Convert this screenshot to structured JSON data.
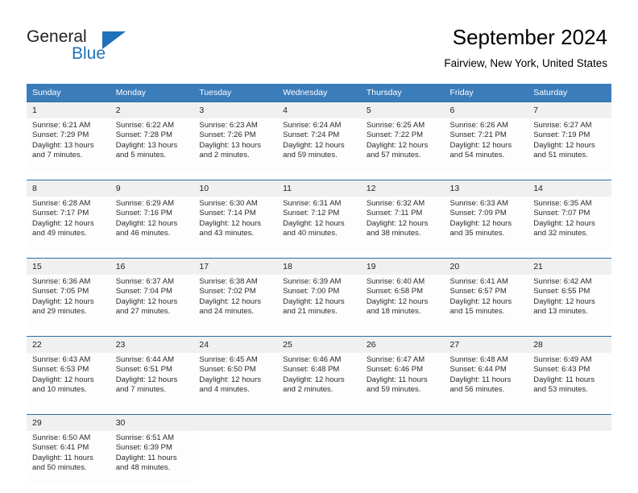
{
  "brand": {
    "name_part1": "General",
    "name_part2": "Blue",
    "flag_icon": "triangle-flag-icon",
    "accent_color": "#1f71b8"
  },
  "header": {
    "title": "September 2024",
    "location": "Fairview, New York, United States"
  },
  "calendar": {
    "header_bg": "#3b7cba",
    "daynum_bg": "#f0f0f0",
    "separator_color": "#2e6da4",
    "weekday_headers": [
      "Sunday",
      "Monday",
      "Tuesday",
      "Wednesday",
      "Thursday",
      "Friday",
      "Saturday"
    ],
    "weeks": [
      [
        {
          "day": "1",
          "sunrise": "Sunrise: 6:21 AM",
          "sunset": "Sunset: 7:29 PM",
          "daylight_line1": "Daylight: 13 hours",
          "daylight_line2": "and 7 minutes."
        },
        {
          "day": "2",
          "sunrise": "Sunrise: 6:22 AM",
          "sunset": "Sunset: 7:28 PM",
          "daylight_line1": "Daylight: 13 hours",
          "daylight_line2": "and 5 minutes."
        },
        {
          "day": "3",
          "sunrise": "Sunrise: 6:23 AM",
          "sunset": "Sunset: 7:26 PM",
          "daylight_line1": "Daylight: 13 hours",
          "daylight_line2": "and 2 minutes."
        },
        {
          "day": "4",
          "sunrise": "Sunrise: 6:24 AM",
          "sunset": "Sunset: 7:24 PM",
          "daylight_line1": "Daylight: 12 hours",
          "daylight_line2": "and 59 minutes."
        },
        {
          "day": "5",
          "sunrise": "Sunrise: 6:25 AM",
          "sunset": "Sunset: 7:22 PM",
          "daylight_line1": "Daylight: 12 hours",
          "daylight_line2": "and 57 minutes."
        },
        {
          "day": "6",
          "sunrise": "Sunrise: 6:26 AM",
          "sunset": "Sunset: 7:21 PM",
          "daylight_line1": "Daylight: 12 hours",
          "daylight_line2": "and 54 minutes."
        },
        {
          "day": "7",
          "sunrise": "Sunrise: 6:27 AM",
          "sunset": "Sunset: 7:19 PM",
          "daylight_line1": "Daylight: 12 hours",
          "daylight_line2": "and 51 minutes."
        }
      ],
      [
        {
          "day": "8",
          "sunrise": "Sunrise: 6:28 AM",
          "sunset": "Sunset: 7:17 PM",
          "daylight_line1": "Daylight: 12 hours",
          "daylight_line2": "and 49 minutes."
        },
        {
          "day": "9",
          "sunrise": "Sunrise: 6:29 AM",
          "sunset": "Sunset: 7:16 PM",
          "daylight_line1": "Daylight: 12 hours",
          "daylight_line2": "and 46 minutes."
        },
        {
          "day": "10",
          "sunrise": "Sunrise: 6:30 AM",
          "sunset": "Sunset: 7:14 PM",
          "daylight_line1": "Daylight: 12 hours",
          "daylight_line2": "and 43 minutes."
        },
        {
          "day": "11",
          "sunrise": "Sunrise: 6:31 AM",
          "sunset": "Sunset: 7:12 PM",
          "daylight_line1": "Daylight: 12 hours",
          "daylight_line2": "and 40 minutes."
        },
        {
          "day": "12",
          "sunrise": "Sunrise: 6:32 AM",
          "sunset": "Sunset: 7:11 PM",
          "daylight_line1": "Daylight: 12 hours",
          "daylight_line2": "and 38 minutes."
        },
        {
          "day": "13",
          "sunrise": "Sunrise: 6:33 AM",
          "sunset": "Sunset: 7:09 PM",
          "daylight_line1": "Daylight: 12 hours",
          "daylight_line2": "and 35 minutes."
        },
        {
          "day": "14",
          "sunrise": "Sunrise: 6:35 AM",
          "sunset": "Sunset: 7:07 PM",
          "daylight_line1": "Daylight: 12 hours",
          "daylight_line2": "and 32 minutes."
        }
      ],
      [
        {
          "day": "15",
          "sunrise": "Sunrise: 6:36 AM",
          "sunset": "Sunset: 7:05 PM",
          "daylight_line1": "Daylight: 12 hours",
          "daylight_line2": "and 29 minutes."
        },
        {
          "day": "16",
          "sunrise": "Sunrise: 6:37 AM",
          "sunset": "Sunset: 7:04 PM",
          "daylight_line1": "Daylight: 12 hours",
          "daylight_line2": "and 27 minutes."
        },
        {
          "day": "17",
          "sunrise": "Sunrise: 6:38 AM",
          "sunset": "Sunset: 7:02 PM",
          "daylight_line1": "Daylight: 12 hours",
          "daylight_line2": "and 24 minutes."
        },
        {
          "day": "18",
          "sunrise": "Sunrise: 6:39 AM",
          "sunset": "Sunset: 7:00 PM",
          "daylight_line1": "Daylight: 12 hours",
          "daylight_line2": "and 21 minutes."
        },
        {
          "day": "19",
          "sunrise": "Sunrise: 6:40 AM",
          "sunset": "Sunset: 6:58 PM",
          "daylight_line1": "Daylight: 12 hours",
          "daylight_line2": "and 18 minutes."
        },
        {
          "day": "20",
          "sunrise": "Sunrise: 6:41 AM",
          "sunset": "Sunset: 6:57 PM",
          "daylight_line1": "Daylight: 12 hours",
          "daylight_line2": "and 15 minutes."
        },
        {
          "day": "21",
          "sunrise": "Sunrise: 6:42 AM",
          "sunset": "Sunset: 6:55 PM",
          "daylight_line1": "Daylight: 12 hours",
          "daylight_line2": "and 13 minutes."
        }
      ],
      [
        {
          "day": "22",
          "sunrise": "Sunrise: 6:43 AM",
          "sunset": "Sunset: 6:53 PM",
          "daylight_line1": "Daylight: 12 hours",
          "daylight_line2": "and 10 minutes."
        },
        {
          "day": "23",
          "sunrise": "Sunrise: 6:44 AM",
          "sunset": "Sunset: 6:51 PM",
          "daylight_line1": "Daylight: 12 hours",
          "daylight_line2": "and 7 minutes."
        },
        {
          "day": "24",
          "sunrise": "Sunrise: 6:45 AM",
          "sunset": "Sunset: 6:50 PM",
          "daylight_line1": "Daylight: 12 hours",
          "daylight_line2": "and 4 minutes."
        },
        {
          "day": "25",
          "sunrise": "Sunrise: 6:46 AM",
          "sunset": "Sunset: 6:48 PM",
          "daylight_line1": "Daylight: 12 hours",
          "daylight_line2": "and 2 minutes."
        },
        {
          "day": "26",
          "sunrise": "Sunrise: 6:47 AM",
          "sunset": "Sunset: 6:46 PM",
          "daylight_line1": "Daylight: 11 hours",
          "daylight_line2": "and 59 minutes."
        },
        {
          "day": "27",
          "sunrise": "Sunrise: 6:48 AM",
          "sunset": "Sunset: 6:44 PM",
          "daylight_line1": "Daylight: 11 hours",
          "daylight_line2": "and 56 minutes."
        },
        {
          "day": "28",
          "sunrise": "Sunrise: 6:49 AM",
          "sunset": "Sunset: 6:43 PM",
          "daylight_line1": "Daylight: 11 hours",
          "daylight_line2": "and 53 minutes."
        }
      ],
      [
        {
          "day": "29",
          "sunrise": "Sunrise: 6:50 AM",
          "sunset": "Sunset: 6:41 PM",
          "daylight_line1": "Daylight: 11 hours",
          "daylight_line2": "and 50 minutes."
        },
        {
          "day": "30",
          "sunrise": "Sunrise: 6:51 AM",
          "sunset": "Sunset: 6:39 PM",
          "daylight_line1": "Daylight: 11 hours",
          "daylight_line2": "and 48 minutes."
        },
        {
          "day": "",
          "sunrise": "",
          "sunset": "",
          "daylight_line1": "",
          "daylight_line2": ""
        },
        {
          "day": "",
          "sunrise": "",
          "sunset": "",
          "daylight_line1": "",
          "daylight_line2": ""
        },
        {
          "day": "",
          "sunrise": "",
          "sunset": "",
          "daylight_line1": "",
          "daylight_line2": ""
        },
        {
          "day": "",
          "sunrise": "",
          "sunset": "",
          "daylight_line1": "",
          "daylight_line2": ""
        },
        {
          "day": "",
          "sunrise": "",
          "sunset": "",
          "daylight_line1": "",
          "daylight_line2": ""
        }
      ]
    ]
  }
}
